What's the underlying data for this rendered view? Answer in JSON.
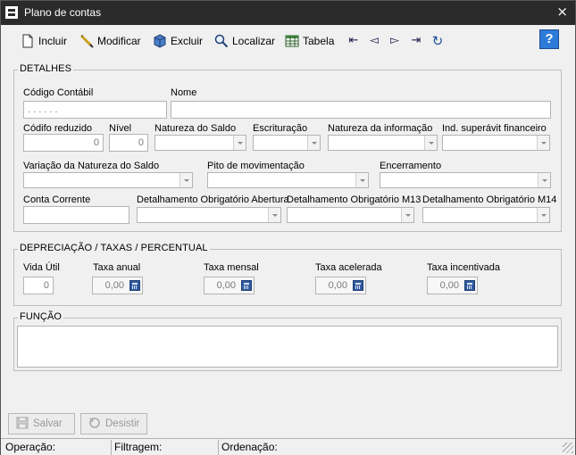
{
  "window": {
    "title": "Plano de contas",
    "close_glyph": "×"
  },
  "toolbar": {
    "incluir": "Incluir",
    "modificar": "Modificar",
    "excluir": "Excluir",
    "localizar": "Localizar",
    "tabela": "Tabela",
    "nav_first": "⇤",
    "nav_prev": "◅",
    "nav_next": "▻",
    "nav_last": "⇥",
    "refresh": "↻",
    "help": "?"
  },
  "detalhes": {
    "legend": "DETALHES",
    "codigo_contabil": {
      "label": "Código Contábil",
      "value": ". . . . . ."
    },
    "nome": {
      "label": "Nome",
      "value": ""
    },
    "codigo_reduzido": {
      "label": "Códifo reduzido",
      "value": "0"
    },
    "nivel": {
      "label": "Nível",
      "value": "0"
    },
    "natureza_saldo": {
      "label": "Natureza do Saldo"
    },
    "escrituracao": {
      "label": "Escrituração"
    },
    "natureza_informacao": {
      "label": "Natureza da informação"
    },
    "ind_superavit": {
      "label": "Ind. superávit financeiro"
    },
    "variacao_natureza": {
      "label": "Variação da Natureza do Saldo"
    },
    "tipo_movimentacao": {
      "label": "Pito de movimentação"
    },
    "encerramento": {
      "label": "Encerramento"
    },
    "conta_corrente": {
      "label": "Conta Corrente",
      "value": ""
    },
    "det_abertura": {
      "label": "Detalhamento Obrigatório Abertura"
    },
    "det_m13": {
      "label": "Detalhamento Obrigatório M13"
    },
    "det_m14": {
      "label": "Detalhamento Obrigatório M14"
    }
  },
  "depreciacao": {
    "legend": "DEPRECIAÇÃO / TAXAS / PERCENTUAL",
    "vida_util": {
      "label": "Vida Útil",
      "value": "0"
    },
    "taxa_anual": {
      "label": "Taxa anual",
      "value": "0,00"
    },
    "taxa_mensal": {
      "label": "Taxa mensal",
      "value": "0,00"
    },
    "taxa_acelerada": {
      "label": "Taxa acelerada",
      "value": "0,00"
    },
    "taxa_incentivada": {
      "label": "Taxa incentivada",
      "value": "0,00"
    }
  },
  "funcao": {
    "legend": "FUNÇÃO",
    "value": ""
  },
  "footer": {
    "salvar": "Salvar",
    "desistir": "Desistir"
  },
  "status": {
    "operacao": "Operação:",
    "filtragem": "Filtragem:",
    "ordenacao": "Ordenação:"
  },
  "colors": {
    "titlebar": "#2b2b2b",
    "window_bg": "#f0f0f0",
    "help_blue": "#2d7bd8"
  }
}
